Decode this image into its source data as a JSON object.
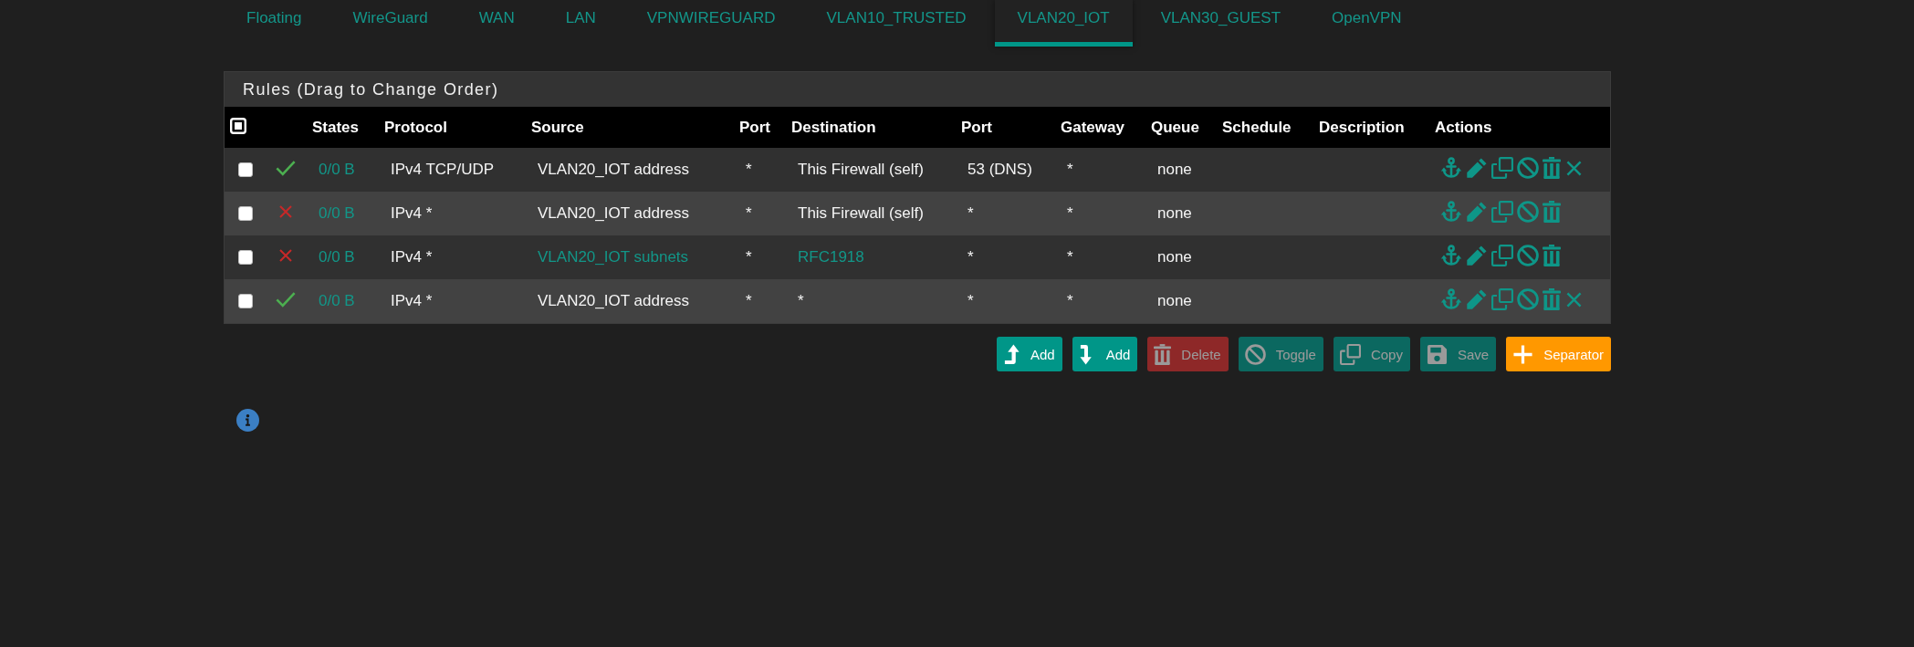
{
  "tabs": [
    {
      "label": "Floating",
      "selected": false
    },
    {
      "label": "WireGuard",
      "selected": false
    },
    {
      "label": "WAN",
      "selected": false
    },
    {
      "label": "LAN",
      "selected": false
    },
    {
      "label": "VPNWIREGUARD",
      "selected": false
    },
    {
      "label": "VLAN10_TRUSTED",
      "selected": false
    },
    {
      "label": "VLAN20_IOT",
      "selected": true
    },
    {
      "label": "VLAN30_GUEST",
      "selected": false
    },
    {
      "label": "OpenVPN",
      "selected": false
    }
  ],
  "panel": {
    "title": "Rules (Drag to Change Order)",
    "table": {
      "columns": [
        "States",
        "Protocol",
        "Source",
        "Port",
        "Destination",
        "Port",
        "Gateway",
        "Queue",
        "Schedule",
        "Description",
        "Actions"
      ],
      "rows": [
        {
          "checked": false,
          "kind": "pass",
          "states": "0/0 B",
          "protocol": "IPv4 TCP/UDP",
          "source": {
            "text": "VLAN20_IOT address",
            "link": false
          },
          "port": "*",
          "destination": {
            "text": "This Firewall (self)",
            "link": false
          },
          "dest_port": "53 (DNS)",
          "gateway": "*",
          "queue": "none",
          "actions": [
            {
              "kind": "anchor"
            },
            {
              "kind": "edit"
            },
            {
              "kind": "copy"
            },
            {
              "kind": "disable"
            },
            {
              "kind": "delete"
            },
            {
              "kind": "x"
            }
          ]
        },
        {
          "checked": false,
          "kind": "block",
          "states": "0/0 B",
          "protocol": "IPv4 *",
          "source": {
            "text": "VLAN20_IOT address",
            "link": false
          },
          "port": "*",
          "destination": {
            "text": "This Firewall (self)",
            "link": false
          },
          "dest_port": "*",
          "gateway": "*",
          "queue": "none",
          "actions": [
            {
              "kind": "anchor"
            },
            {
              "kind": "edit"
            },
            {
              "kind": "copy"
            },
            {
              "kind": "disable"
            },
            {
              "kind": "delete"
            }
          ]
        },
        {
          "checked": false,
          "kind": "block",
          "states": "0/0 B",
          "protocol": "IPv4 *",
          "source": {
            "text": "VLAN20_IOT subnets",
            "link": true
          },
          "port": "*",
          "destination": {
            "text": "RFC1918",
            "link": true
          },
          "dest_port": "*",
          "gateway": "*",
          "queue": "none",
          "actions": [
            {
              "kind": "anchor"
            },
            {
              "kind": "edit"
            },
            {
              "kind": "copy"
            },
            {
              "kind": "disable"
            },
            {
              "kind": "delete"
            }
          ]
        },
        {
          "checked": false,
          "kind": "pass",
          "states": "0/0 B",
          "protocol": "IPv4 *",
          "source": {
            "text": "VLAN20_IOT address",
            "link": false
          },
          "port": "*",
          "destination": {
            "text": "*",
            "link": false
          },
          "dest_port": "*",
          "gateway": "*",
          "queue": "none",
          "actions": [
            {
              "kind": "anchor"
            },
            {
              "kind": "edit"
            },
            {
              "kind": "copy"
            },
            {
              "kind": "disable"
            },
            {
              "kind": "delete"
            },
            {
              "kind": "x"
            }
          ]
        }
      ]
    }
  },
  "buttons": [
    {
      "kind": "add_above",
      "label": "Add",
      "disabled": false
    },
    {
      "kind": "add_below",
      "label": "Add",
      "disabled": false
    },
    {
      "kind": "delete",
      "label": "Delete",
      "disabled": true
    },
    {
      "kind": "toggle",
      "label": "Toggle",
      "disabled": true
    },
    {
      "kind": "copy",
      "label": "Copy",
      "disabled": true
    },
    {
      "kind": "save",
      "label": "Save",
      "disabled": true
    },
    {
      "kind": "separator",
      "label": "Separator",
      "disabled": false
    }
  ]
}
